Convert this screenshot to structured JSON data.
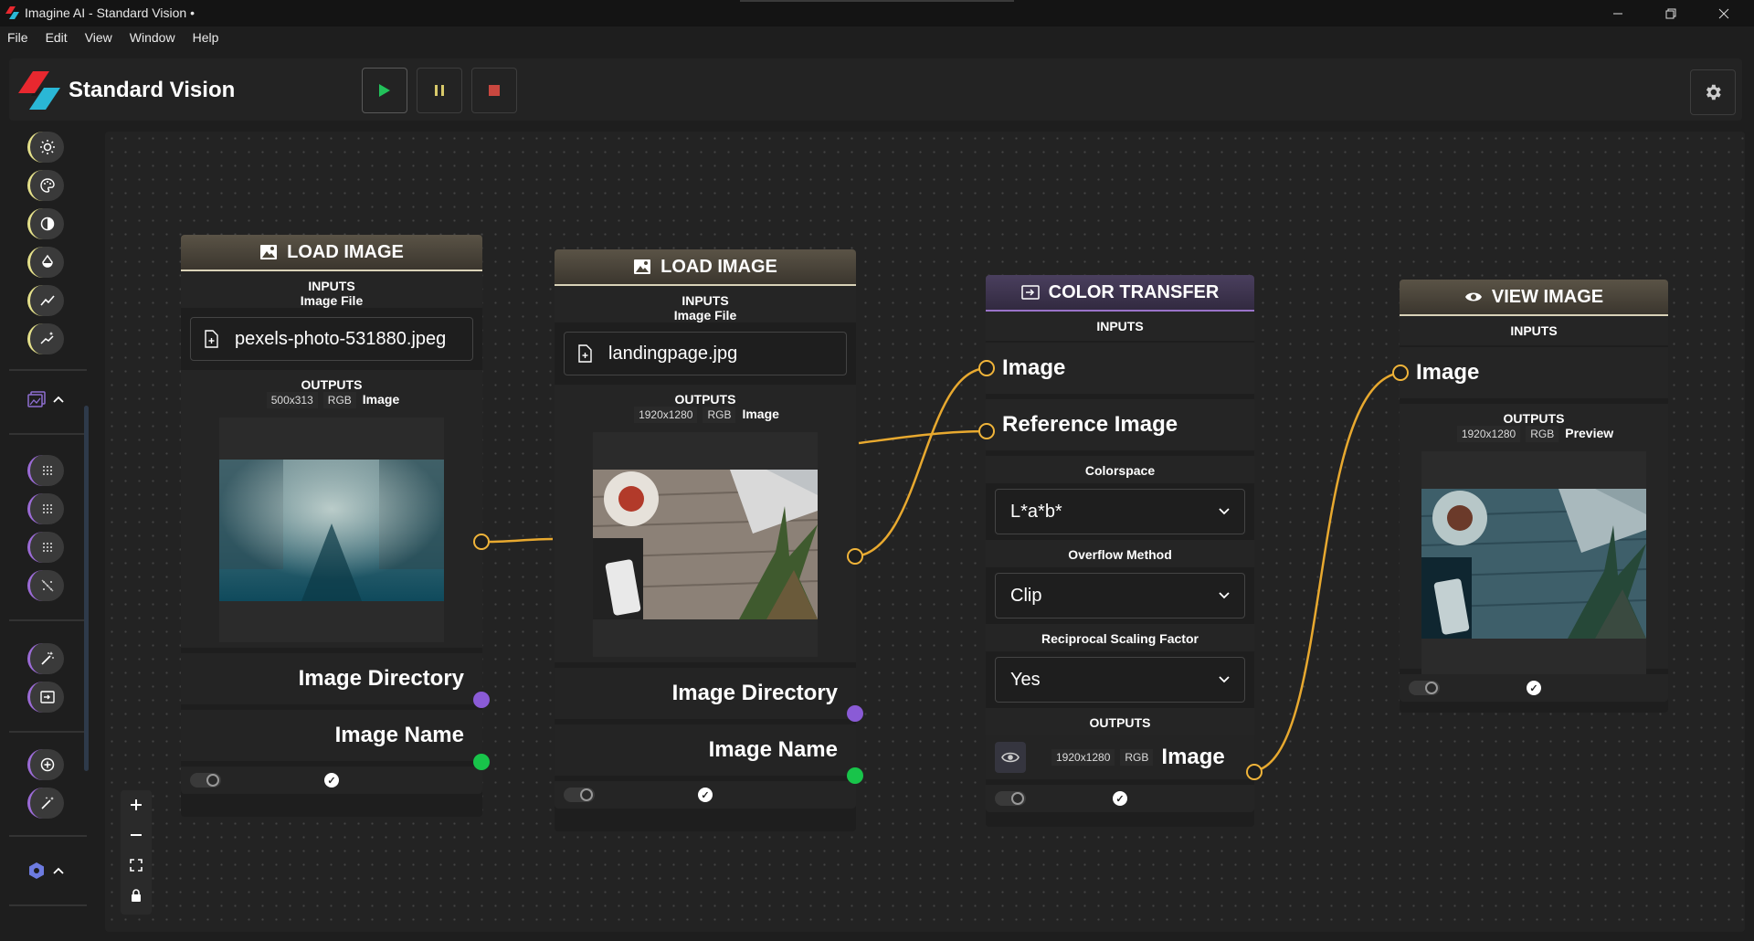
{
  "window": {
    "title": "Imagine AI - Standard Vision •"
  },
  "menu": [
    "File",
    "Edit",
    "View",
    "Window",
    "Help"
  ],
  "header": {
    "brand": "Standard Vision"
  },
  "nodes": {
    "load1": {
      "title": "LOAD IMAGE",
      "inputs_label": "INPUTS",
      "input_name": "Image File",
      "file": "pexels-photo-531880.jpeg",
      "outputs_label": "OUTPUTS",
      "dims": "500x313",
      "mode": "RGB",
      "output_name": "Image",
      "out_dir": "Image Directory",
      "out_name": "Image Name"
    },
    "load2": {
      "title": "LOAD IMAGE",
      "inputs_label": "INPUTS",
      "input_name": "Image File",
      "file": "landingpage.jpg",
      "outputs_label": "OUTPUTS",
      "dims": "1920x1280",
      "mode": "RGB",
      "output_name": "Image",
      "out_dir": "Image Directory",
      "out_name": "Image Name"
    },
    "transfer": {
      "title": "COLOR TRANSFER",
      "inputs_label": "INPUTS",
      "in_image": "Image",
      "in_ref": "Reference Image",
      "colorspace_label": "Colorspace",
      "colorspace_value": "L*a*b*",
      "overflow_label": "Overflow Method",
      "overflow_value": "Clip",
      "scaling_label": "Reciprocal Scaling Factor",
      "scaling_value": "Yes",
      "outputs_label": "OUTPUTS",
      "dims": "1920x1280",
      "mode": "RGB",
      "output_name": "Image"
    },
    "view": {
      "title": "VIEW IMAGE",
      "inputs_label": "INPUTS",
      "in_image": "Image",
      "outputs_label": "OUTPUTS",
      "dims": "1920x1280",
      "mode": "RGB",
      "output_name": "Preview"
    }
  },
  "colors": {
    "image_port": "#f0b43a",
    "directory_port": "#8a5bd6",
    "name_port": "#18c44a",
    "wire": "#e8a92f",
    "node_header_gold_accent": "#d9d2b8",
    "node_header_purple_accent": "#9a73c9"
  },
  "icons": [
    "brightness-icon",
    "palette-icon",
    "contrast-icon",
    "drop-icon",
    "trend-icon",
    "sparkle-chart-icon",
    "gallery-icon",
    "grid-icon",
    "magic-wand-icon",
    "transfer-icon",
    "add-circle-icon",
    "wand-sparkle-icon",
    "hex-gear-icon"
  ]
}
